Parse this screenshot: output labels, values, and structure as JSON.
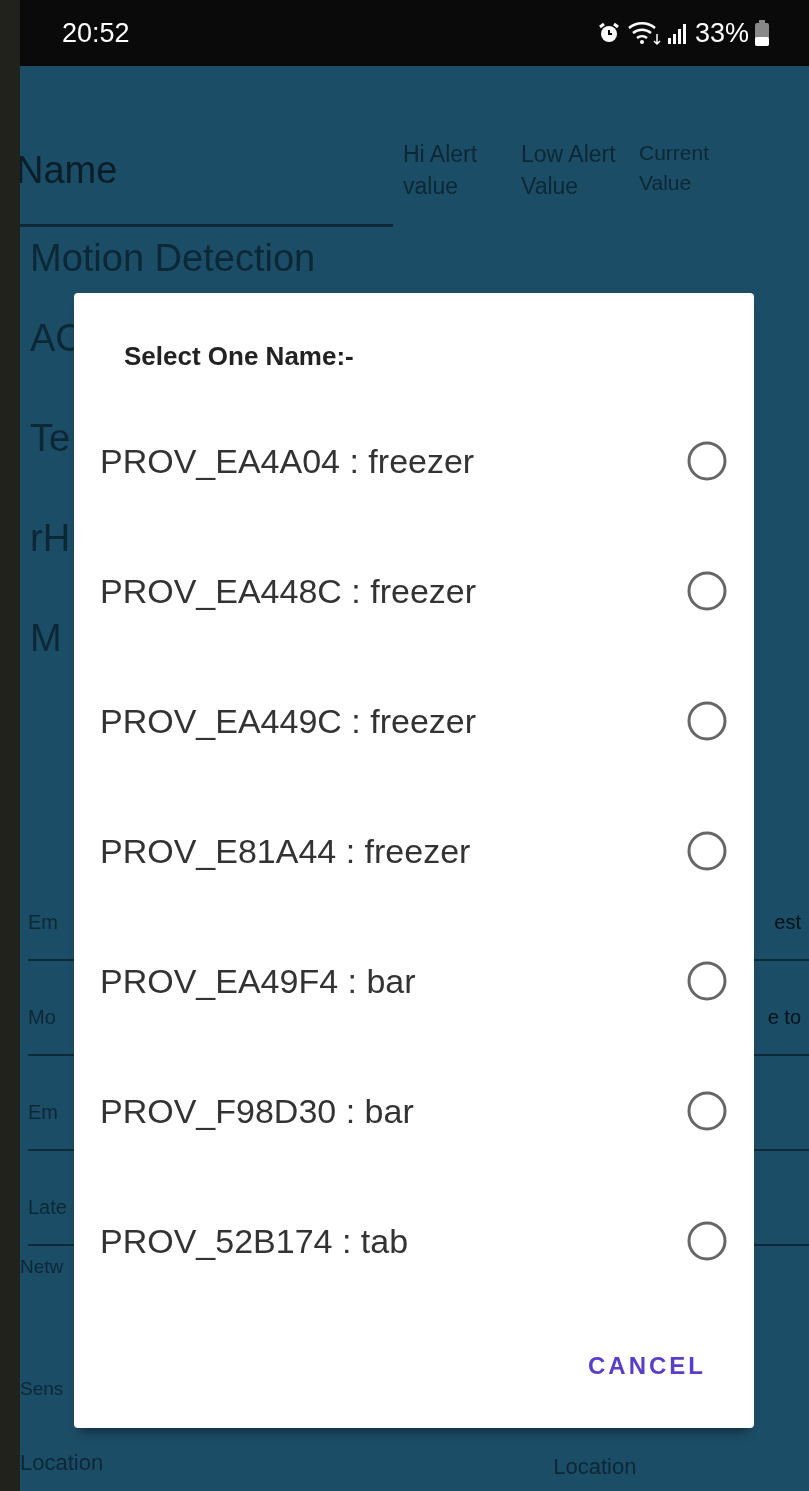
{
  "status_bar": {
    "time": "20:52",
    "battery": "33%"
  },
  "background": {
    "header": {
      "name": "Name",
      "columns": [
        "Hi Alert value",
        "Low Alert Value",
        "Current Value"
      ]
    },
    "rows": [
      "Motion Detection",
      "AC",
      "Te",
      "rH",
      "M"
    ],
    "fields": [
      {
        "left": "Em",
        "right": "est"
      },
      {
        "left": "Mo",
        "right": "e to"
      },
      {
        "left": "Em"
      },
      {
        "left": "Late"
      }
    ],
    "labels": [
      "Netw",
      "Sens"
    ],
    "footer": [
      "Location",
      "Location"
    ]
  },
  "dialog": {
    "title": "Select One Name:-",
    "options": [
      {
        "label": "PROV_EA4A04 : freezer",
        "selected": false
      },
      {
        "label": "PROV_EA448C : freezer",
        "selected": false
      },
      {
        "label": "PROV_EA449C : freezer",
        "selected": false
      },
      {
        "label": "PROV_E81A44 : freezer",
        "selected": false
      },
      {
        "label": "PROV_EA49F4 : bar",
        "selected": false
      },
      {
        "label": "PROV_F98D30 : bar",
        "selected": false
      },
      {
        "label": "PROV_52B174 : tab",
        "selected": false
      }
    ],
    "cancel": "CANCEL"
  }
}
